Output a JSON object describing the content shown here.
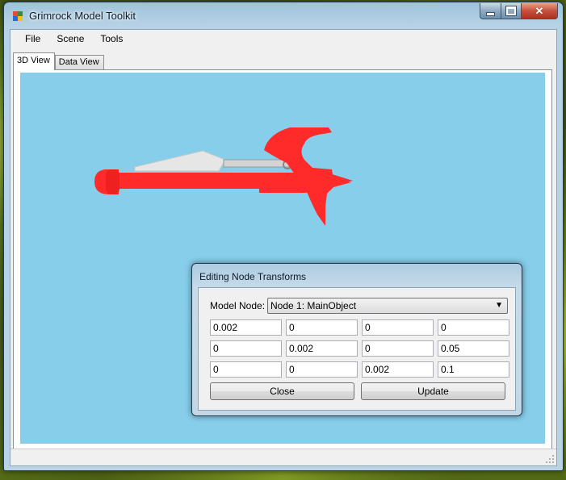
{
  "window": {
    "title": "Grimrock Model Toolkit"
  },
  "menu": {
    "items": [
      "File",
      "Scene",
      "Tools"
    ]
  },
  "tabs": [
    {
      "label": "3D View",
      "active": true
    },
    {
      "label": "Data View",
      "active": false
    }
  ],
  "viewport": {
    "background": "#87ceeb",
    "model_color": "#ff2a2a"
  },
  "dialog": {
    "title": "Editing Node Transforms",
    "model_node_label": "Model Node:",
    "model_node_value": "Node 1: MainObject",
    "matrix": [
      [
        "0.002",
        "0",
        "0",
        "0"
      ],
      [
        "0",
        "0.002",
        "0",
        "0.05"
      ],
      [
        "0",
        "0",
        "0.002",
        "0.1"
      ]
    ],
    "close_label": "Close",
    "update_label": "Update"
  },
  "icons": {
    "app": "grimrock-app-icon",
    "minimize": "minimize-icon",
    "maximize": "maximize-icon",
    "close": "close-icon",
    "dropdown": "chevron-down-icon",
    "grip": "resize-grip-icon"
  }
}
